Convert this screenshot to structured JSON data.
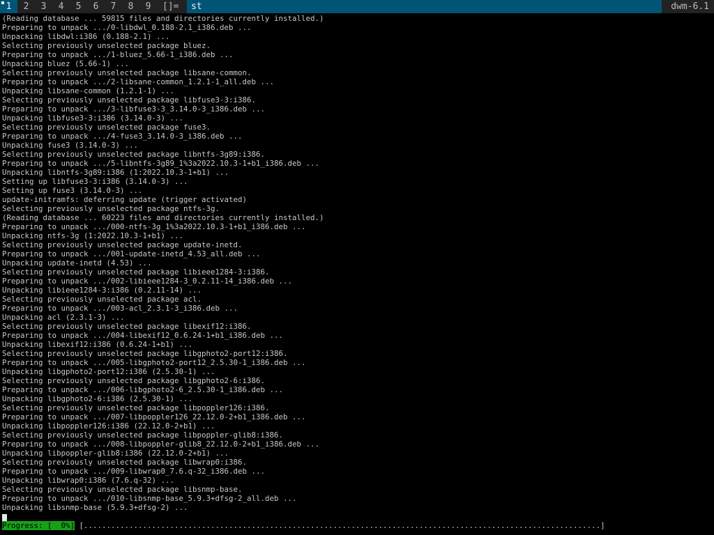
{
  "statusbar": {
    "tags": [
      {
        "label": "1",
        "selected": true,
        "occupied": true
      },
      {
        "label": "2",
        "selected": false,
        "occupied": false
      },
      {
        "label": "3",
        "selected": false,
        "occupied": false
      },
      {
        "label": "4",
        "selected": false,
        "occupied": false
      },
      {
        "label": "5",
        "selected": false,
        "occupied": false
      },
      {
        "label": "6",
        "selected": false,
        "occupied": false
      },
      {
        "label": "7",
        "selected": false,
        "occupied": false
      },
      {
        "label": "8",
        "selected": false,
        "occupied": false
      },
      {
        "label": "9",
        "selected": false,
        "occupied": false
      }
    ],
    "layout_symbol": "[]=",
    "window_title": "st",
    "status_text": "dwm-6.1"
  },
  "colors": {
    "bar_background": "#222222",
    "selected_background": "#005577",
    "bar_text": "#bbbbbb",
    "selected_text": "#eeeeee",
    "terminal_text": "#c8c8c8",
    "progress_green": "#17a117"
  },
  "terminal": {
    "lines": [
      "(Reading database ... 59815 files and directories currently installed.)",
      "Preparing to unpack .../0-libdwl_0.188-2.1_i386.deb ...",
      "Unpacking libdwl:i386 (0.188-2.1) ...",
      "Selecting previously unselected package bluez.",
      "Preparing to unpack .../1-bluez_5.66-1_i386.deb ...",
      "Unpacking bluez (5.66-1) ...",
      "Selecting previously unselected package libsane-common.",
      "Preparing to unpack .../2-libsane-common_1.2.1-1_all.deb ...",
      "Unpacking libsane-common (1.2.1-1) ...",
      "Selecting previously unselected package libfuse3-3:i386.",
      "Preparing to unpack .../3-libfuse3-3_3.14.0-3_i386.deb ...",
      "Unpacking libfuse3-3:i386 (3.14.0-3) ...",
      "Selecting previously unselected package fuse3.",
      "Preparing to unpack .../4-fuse3_3.14.0-3_i386.deb ...",
      "Unpacking fuse3 (3.14.0-3) ...",
      "Selecting previously unselected package libntfs-3g89:i386.",
      "Preparing to unpack .../5-libntfs-3g89_1%3a2022.10.3-1+b1_i386.deb ...",
      "Unpacking libntfs-3g89:i386 (1:2022.10.3-1+b1) ...",
      "Setting up libfuse3-3:i386 (3.14.0-3) ...",
      "Setting up fuse3 (3.14.0-3) ...",
      "update-initramfs: deferring update (trigger activated)",
      "Selecting previously unselected package ntfs-3g.",
      "(Reading database ... 60223 files and directories currently installed.)",
      "Preparing to unpack .../000-ntfs-3g_1%3a2022.10.3-1+b1_i386.deb ...",
      "Unpacking ntfs-3g (1:2022.10.3-1+b1) ...",
      "Selecting previously unselected package update-inetd.",
      "Preparing to unpack .../001-update-inetd_4.53_all.deb ...",
      "Unpacking update-inetd (4.53) ...",
      "Selecting previously unselected package libieee1284-3:i386.",
      "Preparing to unpack .../002-libieee1284-3_0.2.11-14_i386.deb ...",
      "Unpacking libieee1284-3:i386 (0.2.11-14) ...",
      "Selecting previously unselected package acl.",
      "Preparing to unpack .../003-acl_2.3.1-3_i386.deb ...",
      "Unpacking acl (2.3.1-3) ...",
      "Selecting previously unselected package libexif12:i386.",
      "Preparing to unpack .../004-libexif12_0.6.24-1+b1_i386.deb ...",
      "Unpacking libexif12:i386 (0.6.24-1+b1) ...",
      "Selecting previously unselected package libgphoto2-port12:i386.",
      "Preparing to unpack .../005-libgphoto2-port12_2.5.30-1_i386.deb ...",
      "Unpacking libgphoto2-port12:i386 (2.5.30-1) ...",
      "Selecting previously unselected package libgphoto2-6:i386.",
      "Preparing to unpack .../006-libgphoto2-6_2.5.30-1_i386.deb ...",
      "Unpacking libgphoto2-6:i386 (2.5.30-1) ...",
      "Selecting previously unselected package libpoppler126:i386.",
      "Preparing to unpack .../007-libpoppler126_22.12.0-2+b1_i386.deb ...",
      "Unpacking libpoppler126:i386 (22.12.0-2+b1) ...",
      "Selecting previously unselected package libpoppler-glib8:i386.",
      "Preparing to unpack .../008-libpoppler-glib8_22.12.0-2+b1_i386.deb ...",
      "Unpacking libpoppler-glib8:i386 (22.12.0-2+b1) ...",
      "Selecting previously unselected package libwrap0:i386.",
      "Preparing to unpack .../009-libwrap0_7.6.q-32_i386.deb ...",
      "Unpacking libwrap0:i386 (7.6.q-32) ...",
      "Selecting previously unselected package libsnmp-base.",
      "Preparing to unpack .../010-libsnmp-base_5.9.3+dfsg-2_all.deb ...",
      "Unpacking libsnmp-base (5.9.3+dfsg-2) ..."
    ],
    "progress": {
      "label": "Progress: [  0%]",
      "percent": 0,
      "bar_text": "[..................................................................................................................]"
    }
  }
}
